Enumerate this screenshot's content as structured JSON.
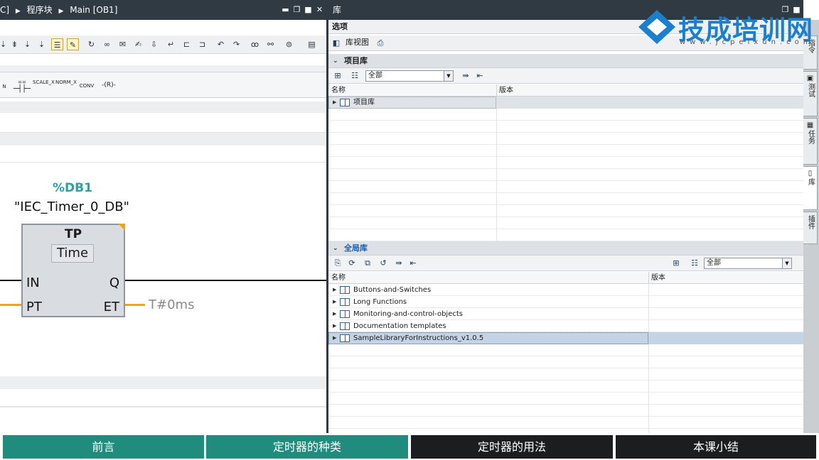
{
  "editor": {
    "breadcrumb": [
      "C]",
      "程序块",
      "Main [OB1]"
    ],
    "instructions": [
      "N",
      "==",
      "SCALE_X",
      "NORM_X",
      "CONV",
      "-(R)-"
    ],
    "block": {
      "db_address": "%DB1",
      "db_name": "\"IEC_Timer_0_DB\"",
      "type": "TP",
      "time_type": "Time",
      "pin_in": "IN",
      "pin_pt": "PT",
      "pin_q": "Q",
      "pin_et": "ET",
      "et_value": "T#0ms"
    }
  },
  "library": {
    "title": "库",
    "options_label": "选项",
    "library_view_label": "库视图",
    "project_library": {
      "title": "项目库",
      "filter_value": "全部",
      "columns": [
        "名称",
        "版本"
      ],
      "items": [
        {
          "name": "项目库",
          "version": ""
        }
      ]
    },
    "global_library": {
      "title": "全局库",
      "filter_value": "全部",
      "columns": [
        "名称",
        "版本"
      ],
      "items": [
        {
          "name": "Buttons-and-Switches",
          "version": ""
        },
        {
          "name": "Long Functions",
          "version": ""
        },
        {
          "name": "Monitoring-and-control-objects",
          "version": ""
        },
        {
          "name": "Documentation templates",
          "version": ""
        },
        {
          "name": "SampleLibraryForInstructions_v1.0.5",
          "version": ""
        }
      ]
    }
  },
  "side_tabs": [
    "指令",
    "测试",
    "任务",
    "库",
    "插件"
  ],
  "watermark": {
    "brand": "技成培训网",
    "url": "www.jcpeixun.com"
  },
  "nav": {
    "buttons": [
      "前言",
      "定时器的种类",
      "定时器的用法",
      "本课小结"
    ],
    "colors": {
      "teal": "#1f8c7d",
      "dark": "#1b1d1f"
    }
  }
}
